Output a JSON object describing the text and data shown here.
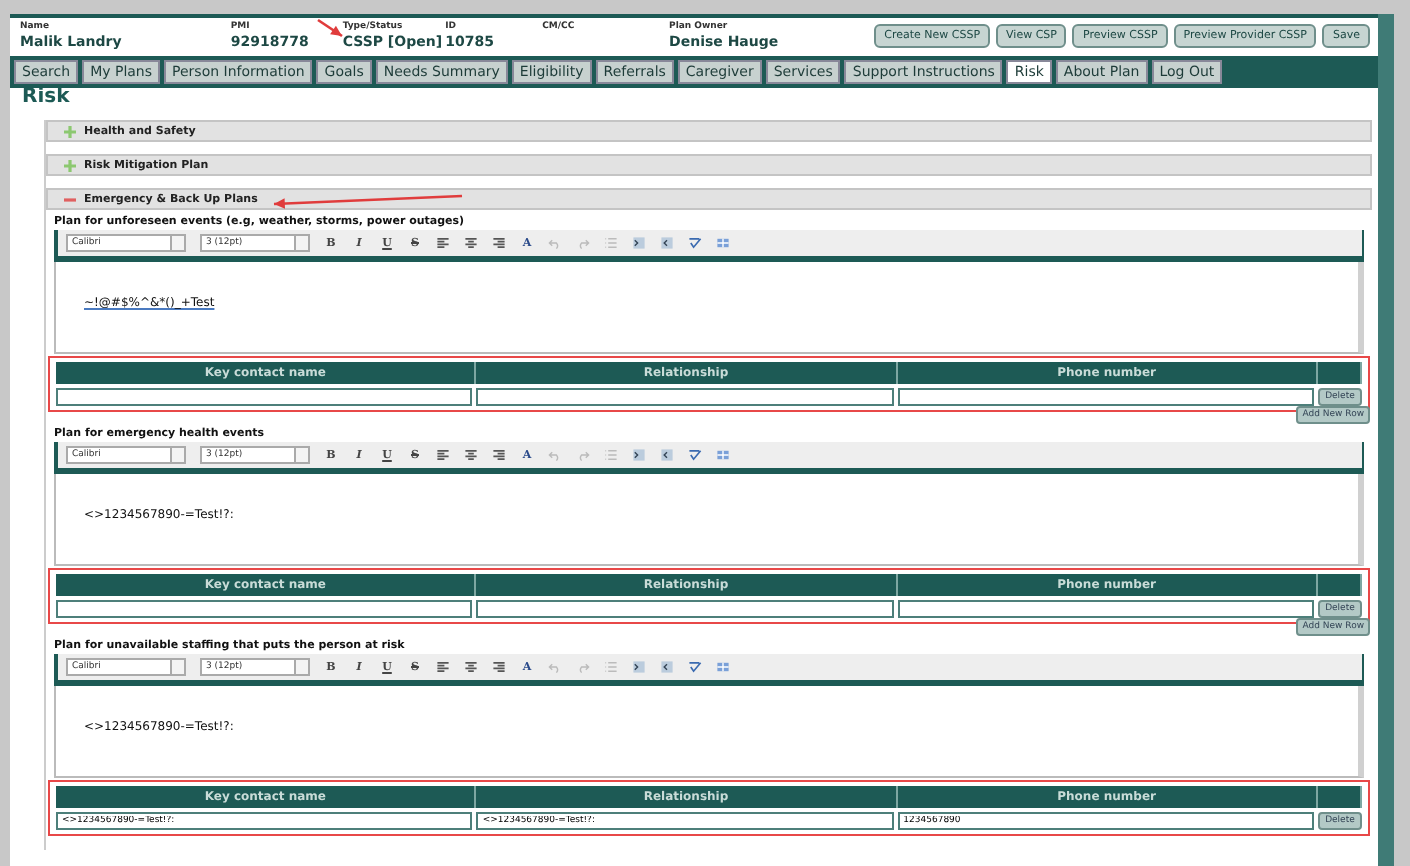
{
  "header": {
    "fields": [
      {
        "label": "Name",
        "value": "Malik Landry",
        "arrow": false
      },
      {
        "label": "PMI",
        "value": "92918778",
        "arrow": false
      },
      {
        "label": "Type/Status",
        "value": "CSSP [Open]",
        "arrow": true
      },
      {
        "label": "ID",
        "value": "10785",
        "arrow": false
      },
      {
        "label": "CM/CC",
        "arrow": false
      },
      {
        "label": "Plan Owner",
        "value": "Denise Hauge",
        "arrow": false
      }
    ],
    "buttons": [
      "Create New CSSP",
      "View CSP",
      "Preview CSSP",
      "Preview Provider CSSP",
      "Save"
    ]
  },
  "tabs": [
    {
      "label": "Search",
      "selected": false
    },
    {
      "label": "My Plans",
      "selected": false
    },
    {
      "label": "Person Information",
      "selected": false
    },
    {
      "label": "Goals",
      "selected": false
    },
    {
      "label": "Needs Summary",
      "selected": false
    },
    {
      "label": "Eligibility",
      "selected": false
    },
    {
      "label": "Referrals",
      "selected": false
    },
    {
      "label": "Caregiver",
      "selected": false
    },
    {
      "label": "Services",
      "selected": false
    },
    {
      "label": "Support Instructions",
      "selected": false
    },
    {
      "label": "Risk",
      "selected": true
    },
    {
      "label": "About Plan",
      "selected": false
    },
    {
      "label": "Log Out",
      "selected": false
    }
  ],
  "page_title": "Risk",
  "accordions": [
    {
      "title": "Health and Safety",
      "expanded": false,
      "arrow": false
    },
    {
      "title": "Risk Mitigation Plan",
      "expanded": false,
      "arrow": false
    },
    {
      "title": "Emergency & Back Up Plans",
      "expanded": true,
      "arrow": true
    }
  ],
  "sections": [
    {
      "label": "Plan for unforeseen events (e.g, weather, storms, power outages)",
      "toolbar": {
        "font": "Calibri",
        "size": "3 (12pt)",
        "format_buttons": [
          "B",
          "I",
          "U",
          "S"
        ],
        "color_button": "A"
      },
      "text": "~!@#$%^&*()_+Test",
      "underlined": true,
      "table": {
        "highlighted": true,
        "columns": [
          "Key contact name",
          "Relationship",
          "Phone number"
        ],
        "delete": "Delete",
        "add": "Add New Row"
      }
    },
    {
      "label": "Plan for emergency health events",
      "toolbar": {
        "font": "Calibri",
        "size": "3 (12pt)",
        "format_buttons": [
          "B",
          "I",
          "U",
          "S"
        ],
        "color_button": "A"
      },
      "text": "<>1234567890-=Test!?:",
      "underlined": false,
      "table": {
        "highlighted": true,
        "columns": [
          "Key contact name",
          "Relationship",
          "Phone number"
        ],
        "delete": "Delete",
        "add": "Add New Row"
      }
    },
    {
      "label": "Plan for unavailable staffing that puts the person at risk",
      "toolbar": {
        "font": "Calibri",
        "size": "3 (12pt)",
        "format_buttons": [
          "B",
          "I",
          "U",
          "S"
        ],
        "color_button": "A"
      },
      "text": "<>1234567890-=Test!?:",
      "underlined": false,
      "table": {
        "highlighted": true,
        "columns": [
          "Key contact name",
          "Relationship",
          "Phone number"
        ],
        "values": [
          "<>1234567890-=Test!?:",
          "<>1234567890-=Test!?:",
          "1234567890"
        ],
        "delete": "Delete"
      }
    }
  ]
}
